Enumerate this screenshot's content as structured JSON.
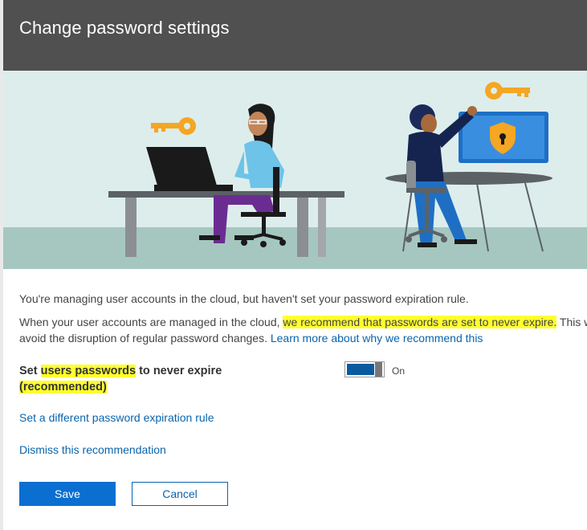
{
  "panel": {
    "title": "Change password settings"
  },
  "body": {
    "intro": "You're managing user accounts in the cloud, but haven't set your password expiration rule.",
    "rec_prefix": "When your user accounts are managed in the cloud, ",
    "rec_highlight": "we recommend that passwords are set to never expire.",
    "rec_suffix": " This will",
    "rec_line2": "avoid the disruption of regular password changes. ",
    "learn_more": "Learn more about why we recommend this"
  },
  "setting": {
    "label_part1": "Set ",
    "label_highlight1": "users passwords",
    "label_part2": " to never expire",
    "label_highlight2": "(recommended)",
    "toggle_state": "On",
    "toggle_on": true
  },
  "links": {
    "different_rule": "Set a different password expiration rule",
    "dismiss": "Dismiss this recommendation"
  },
  "buttons": {
    "save": "Save",
    "cancel": "Cancel"
  },
  "colors": {
    "header_bg": "#505050",
    "accent": "#0a6fd1",
    "link": "#0a64ad",
    "highlight": "#ffff2e",
    "hero_bg": "#dcedec",
    "hero_floor": "#a6c7c0",
    "key": "#f5a623"
  },
  "illustration": {
    "icons": [
      "key-icon",
      "laptop-icon",
      "monitor-icon",
      "shield-lock-icon"
    ]
  }
}
